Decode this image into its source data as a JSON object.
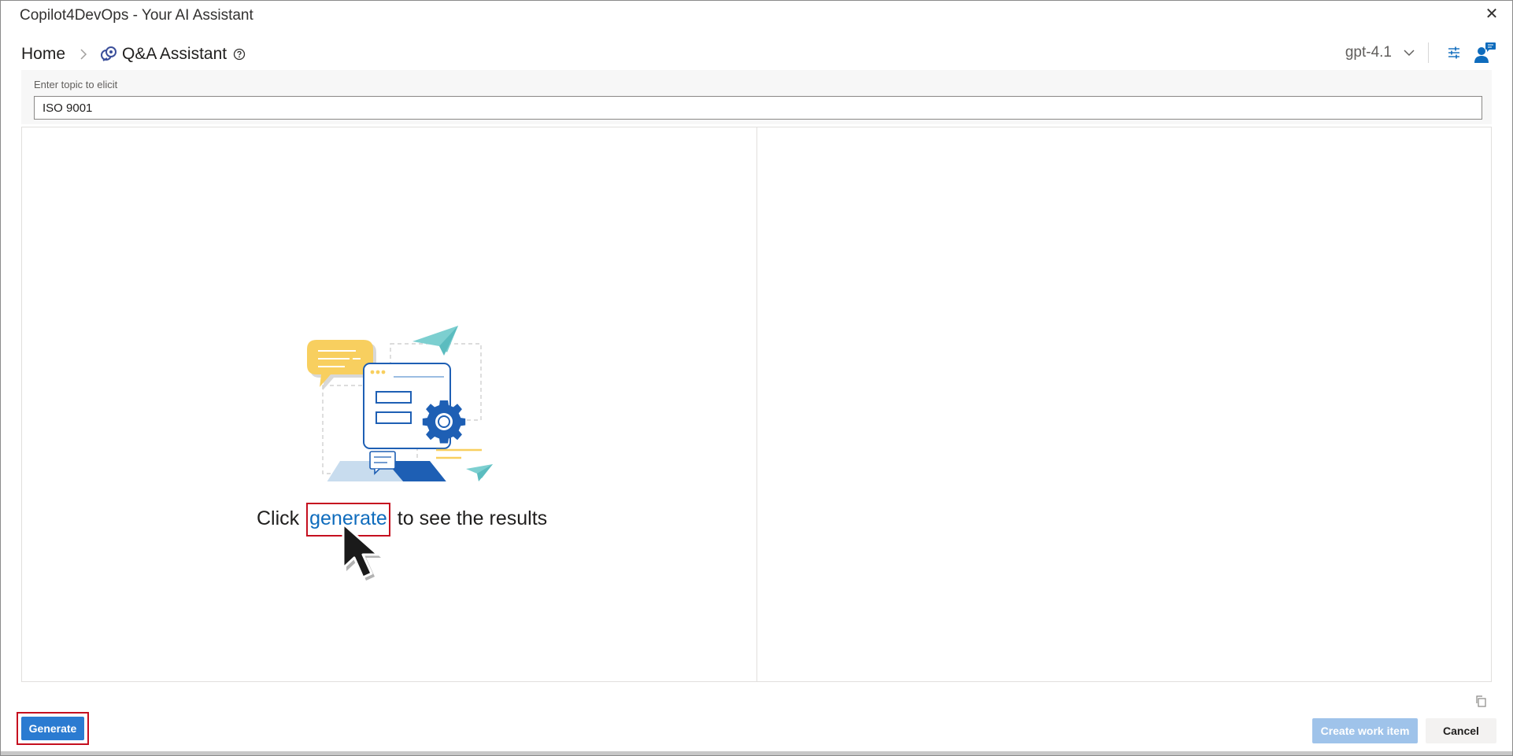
{
  "window": {
    "title": "Copilot4DevOps - Your AI Assistant",
    "close_symbol": "✕"
  },
  "breadcrumb": {
    "home": "Home",
    "current": "Q&A Assistant",
    "app_icon": "copilot-icon",
    "help_icon": "help-circle-icon"
  },
  "toolbar": {
    "model": "gpt-4.1",
    "settings_icon": "sliders-icon",
    "feedback_icon": "person-feedback-icon"
  },
  "topic": {
    "label": "Enter topic to elicit",
    "value": "ISO 9001"
  },
  "empty_state": {
    "prefix": "Click",
    "link": "generate",
    "suffix": "to see the results"
  },
  "footer": {
    "generate_label": "Generate",
    "create_label": "Create work item",
    "cancel_label": "Cancel"
  },
  "colors": {
    "accent": "#2b7bd1",
    "link": "#0f6cbd",
    "highlight": "#c50f1f",
    "disabled_button": "#9fc3ea"
  }
}
